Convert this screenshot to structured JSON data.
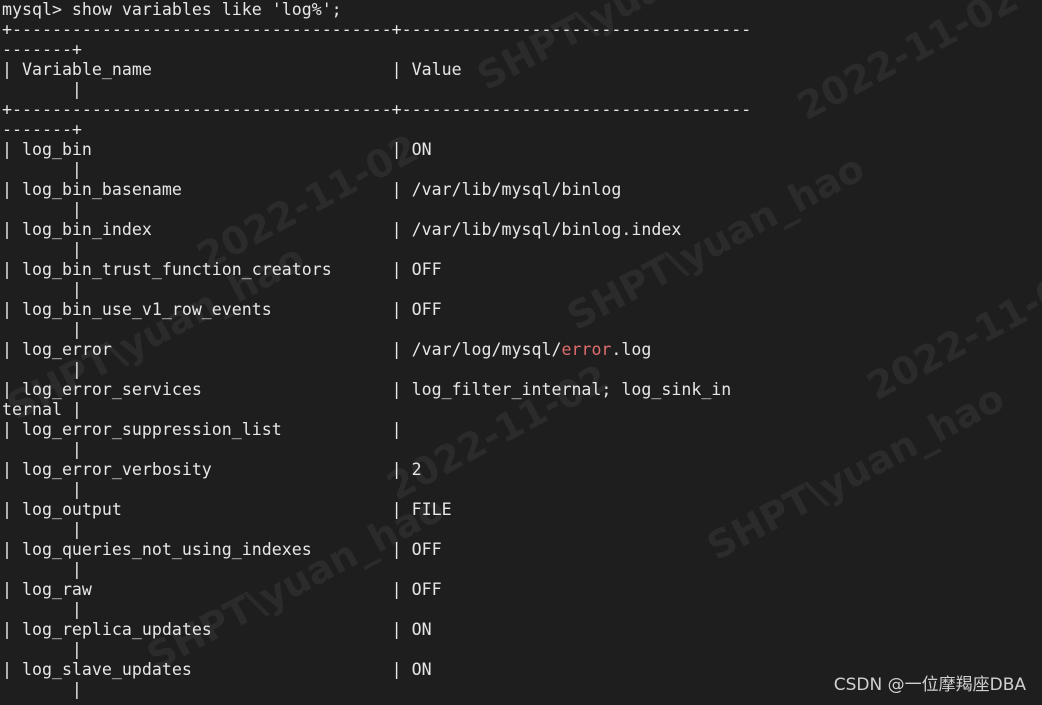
{
  "terminal": {
    "lines": [
      {
        "pre": "mysql> show variables like 'log%';"
      },
      {
        "pre": "+--------------------------------------+-----------------------------------"
      },
      {
        "pre": "-------+"
      },
      {
        "pre": "| Variable_name                        | Value"
      },
      {
        "pre": "       |"
      },
      {
        "pre": "+--------------------------------------+-----------------------------------"
      },
      {
        "pre": "-------+"
      },
      {
        "pre": "| log_bin                              | ON"
      },
      {
        "pre": "       |"
      },
      {
        "pre": "| log_bin_basename                     | /var/lib/mysql/binlog"
      },
      {
        "pre": "       |"
      },
      {
        "pre": "| log_bin_index                        | /var/lib/mysql/binlog.index"
      },
      {
        "pre": "       |"
      },
      {
        "pre": "| log_bin_trust_function_creators      | OFF"
      },
      {
        "pre": "       |"
      },
      {
        "pre": "| log_bin_use_v1_row_events            | OFF"
      },
      {
        "pre": "       |"
      },
      {
        "pre": "| log_error                            | /var/log/mysql/",
        "hl": "error",
        "post": ".log"
      },
      {
        "pre": "       |"
      },
      {
        "pre": "| log_error_services                   | log_filter_internal; log_sink_in"
      },
      {
        "pre": "ternal |"
      },
      {
        "pre": "| log_error_suppression_list           |"
      },
      {
        "pre": "       |"
      },
      {
        "pre": "| log_error_verbosity                  | 2"
      },
      {
        "pre": "       |"
      },
      {
        "pre": "| log_output                           | FILE"
      },
      {
        "pre": "       |"
      },
      {
        "pre": "| log_queries_not_using_indexes        | OFF"
      },
      {
        "pre": "       |"
      },
      {
        "pre": "| log_raw                              | OFF"
      },
      {
        "pre": "       |"
      },
      {
        "pre": "| log_replica_updates                  | ON"
      },
      {
        "pre": "       |"
      },
      {
        "pre": "| log_slave_updates                    | ON"
      },
      {
        "pre": "       |"
      }
    ],
    "highlight_color": "#e06c6c",
    "background_color": "#1e1e1e"
  },
  "watermark": {
    "text_user": "SHPT\\yuan_hao",
    "text_date": "2022-11-02"
  },
  "credit": "CSDN @一位摩羯座DBA"
}
